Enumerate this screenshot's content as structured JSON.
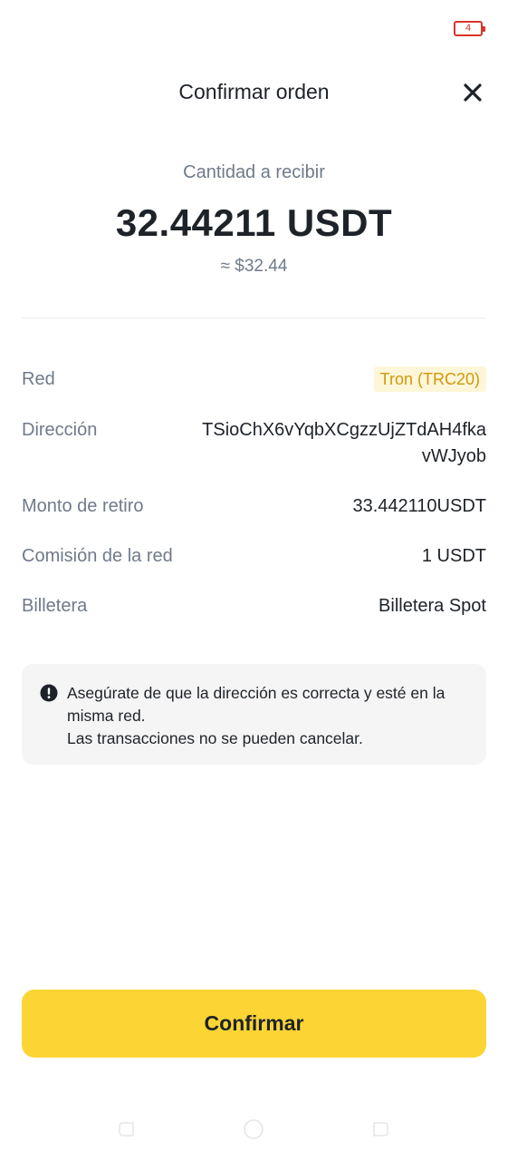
{
  "status_bar": {
    "battery_level": "4"
  },
  "header": {
    "title": "Confirmar orden",
    "close_icon": "close-icon"
  },
  "amount": {
    "label": "Cantidad a recibir",
    "value": "32.44211 USDT",
    "fiat": "≈ $32.44"
  },
  "details": {
    "network": {
      "label": "Red",
      "value": "Tron (TRC20)"
    },
    "address": {
      "label": "Dirección",
      "value": "TSioChX6vYqbXCgzzUjZTdAH4fkavWJyob"
    },
    "withdraw_amount": {
      "label": "Monto de retiro",
      "value": "33.442110USDT"
    },
    "network_fee": {
      "label": "Comisión de la red",
      "value": "1 USDT"
    },
    "wallet": {
      "label": "Billetera",
      "value": "Billetera Spot"
    }
  },
  "warning": {
    "icon": "exclamation-circle-icon",
    "line1": "Asegúrate de que la dirección es correcta y esté en la misma red.",
    "line2": "Las transacciones no se pueden cancelar."
  },
  "confirm_button": {
    "label": "Confirmar"
  },
  "colors": {
    "accent": "#fcd535",
    "badge_bg": "#fdf6d8",
    "badge_text": "#d0980b",
    "battery": "#d9342b"
  }
}
